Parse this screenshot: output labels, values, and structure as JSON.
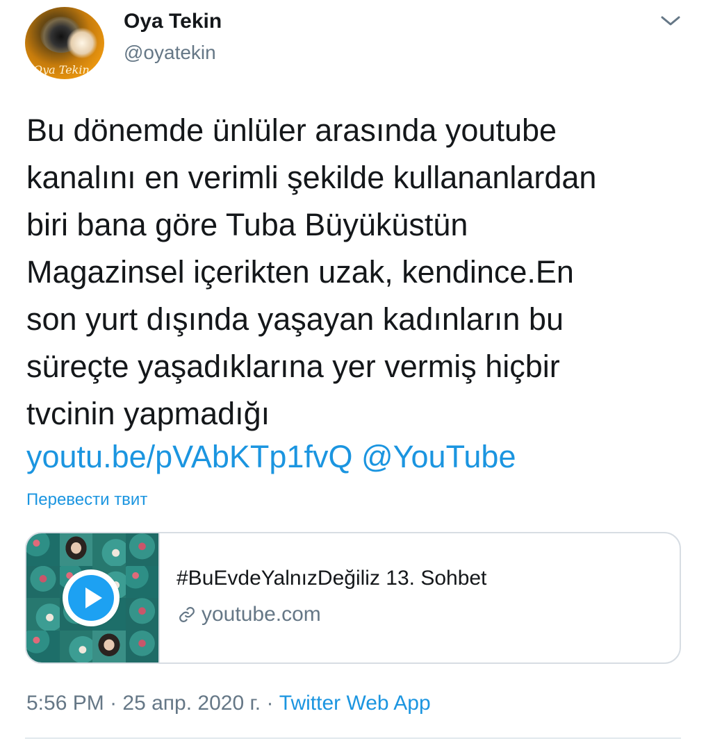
{
  "author": {
    "name": "Oya Tekin",
    "handle": "@oyatekin",
    "avatar_signature": "Oya Tekin"
  },
  "tweet": {
    "text": "Bu dönemde ünlüler arasında youtube\nkanalını en verimli şekilde kullananlardan\nbiri bana göre Tuba Büyüküstün\nMagazinsel içerikten uzak, kendince.En\nson yurt dışında yaşayan kadınların bu\nsüreçte yaşadıklarına yer vermiş hiçbir\ntvcinin yapmadığı",
    "link_url": "youtu.be/pVAbKTp1fvQ",
    "link_mention": "@YouTube",
    "translate_label": "Перевести твит"
  },
  "card": {
    "title": "#BuEvdeYalnızDeğiliz 13. Sohbet",
    "domain": "youtube.com",
    "icon": "link-icon",
    "thumb_icon": "play-icon"
  },
  "footer": {
    "time": "5:56 PM",
    "separator": "·",
    "date": "25 апр. 2020 г.",
    "separator2": "·",
    "source": "Twitter Web App"
  },
  "colors": {
    "accent": "#1b95e0",
    "text": "#14171a",
    "secondary": "#657786",
    "border": "#d7dde3"
  }
}
